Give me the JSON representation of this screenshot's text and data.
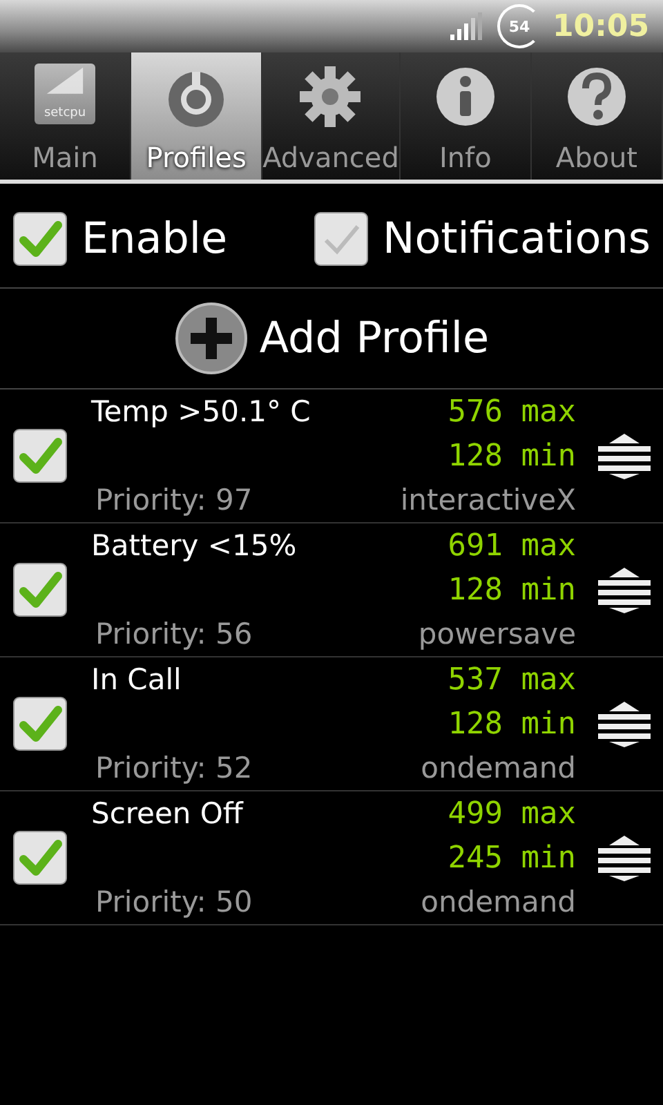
{
  "status_bar": {
    "battery": "54",
    "time": "10:05"
  },
  "tabs": [
    {
      "label": "Main",
      "kind": "logo",
      "logo_text": "setcpu",
      "selected": false
    },
    {
      "label": "Profiles",
      "kind": "profiles",
      "selected": true
    },
    {
      "label": "Advanced",
      "kind": "gear",
      "selected": false
    },
    {
      "label": "Info",
      "kind": "info",
      "selected": false
    },
    {
      "label": "About",
      "kind": "about",
      "selected": false
    }
  ],
  "options": [
    {
      "label": "Enable",
      "checked": true
    },
    {
      "label": "Notifications",
      "checked": false
    }
  ],
  "add_profile": {
    "label": "Add Profile"
  },
  "profiles": [
    {
      "name": "Temp >50.1° C",
      "enabled": true,
      "max": "576 max",
      "min": "128 min",
      "priority": "Priority: 97",
      "governor": "interactiveX"
    },
    {
      "name": "Battery <15%",
      "enabled": true,
      "max": "691 max",
      "min": "128 min",
      "priority": "Priority: 56",
      "governor": "powersave"
    },
    {
      "name": "In Call",
      "enabled": true,
      "max": "537 max",
      "min": "128 min",
      "priority": "Priority: 52",
      "governor": "ondemand"
    },
    {
      "name": "Screen Off",
      "enabled": true,
      "max": "499 max",
      "min": "245 min",
      "priority": "Priority: 50",
      "governor": "ondemand"
    }
  ]
}
